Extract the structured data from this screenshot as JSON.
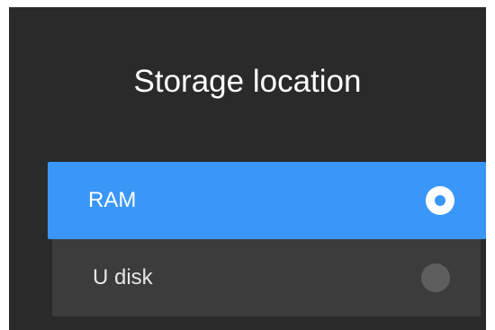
{
  "dialog": {
    "title": "Storage location",
    "options": [
      {
        "label": "RAM",
        "selected": true
      },
      {
        "label": "U disk",
        "selected": false
      }
    ]
  },
  "colors": {
    "dialog_background": "#2a2a2a",
    "selected_background": "#3a97f8",
    "unselected_background": "#3c3c3c",
    "text": "#ffffff",
    "radio_unselected": "#5e5e5e"
  },
  "icons": {
    "selected_radio": "radio-selected-icon",
    "unselected_radio": "radio-unselected-icon"
  }
}
